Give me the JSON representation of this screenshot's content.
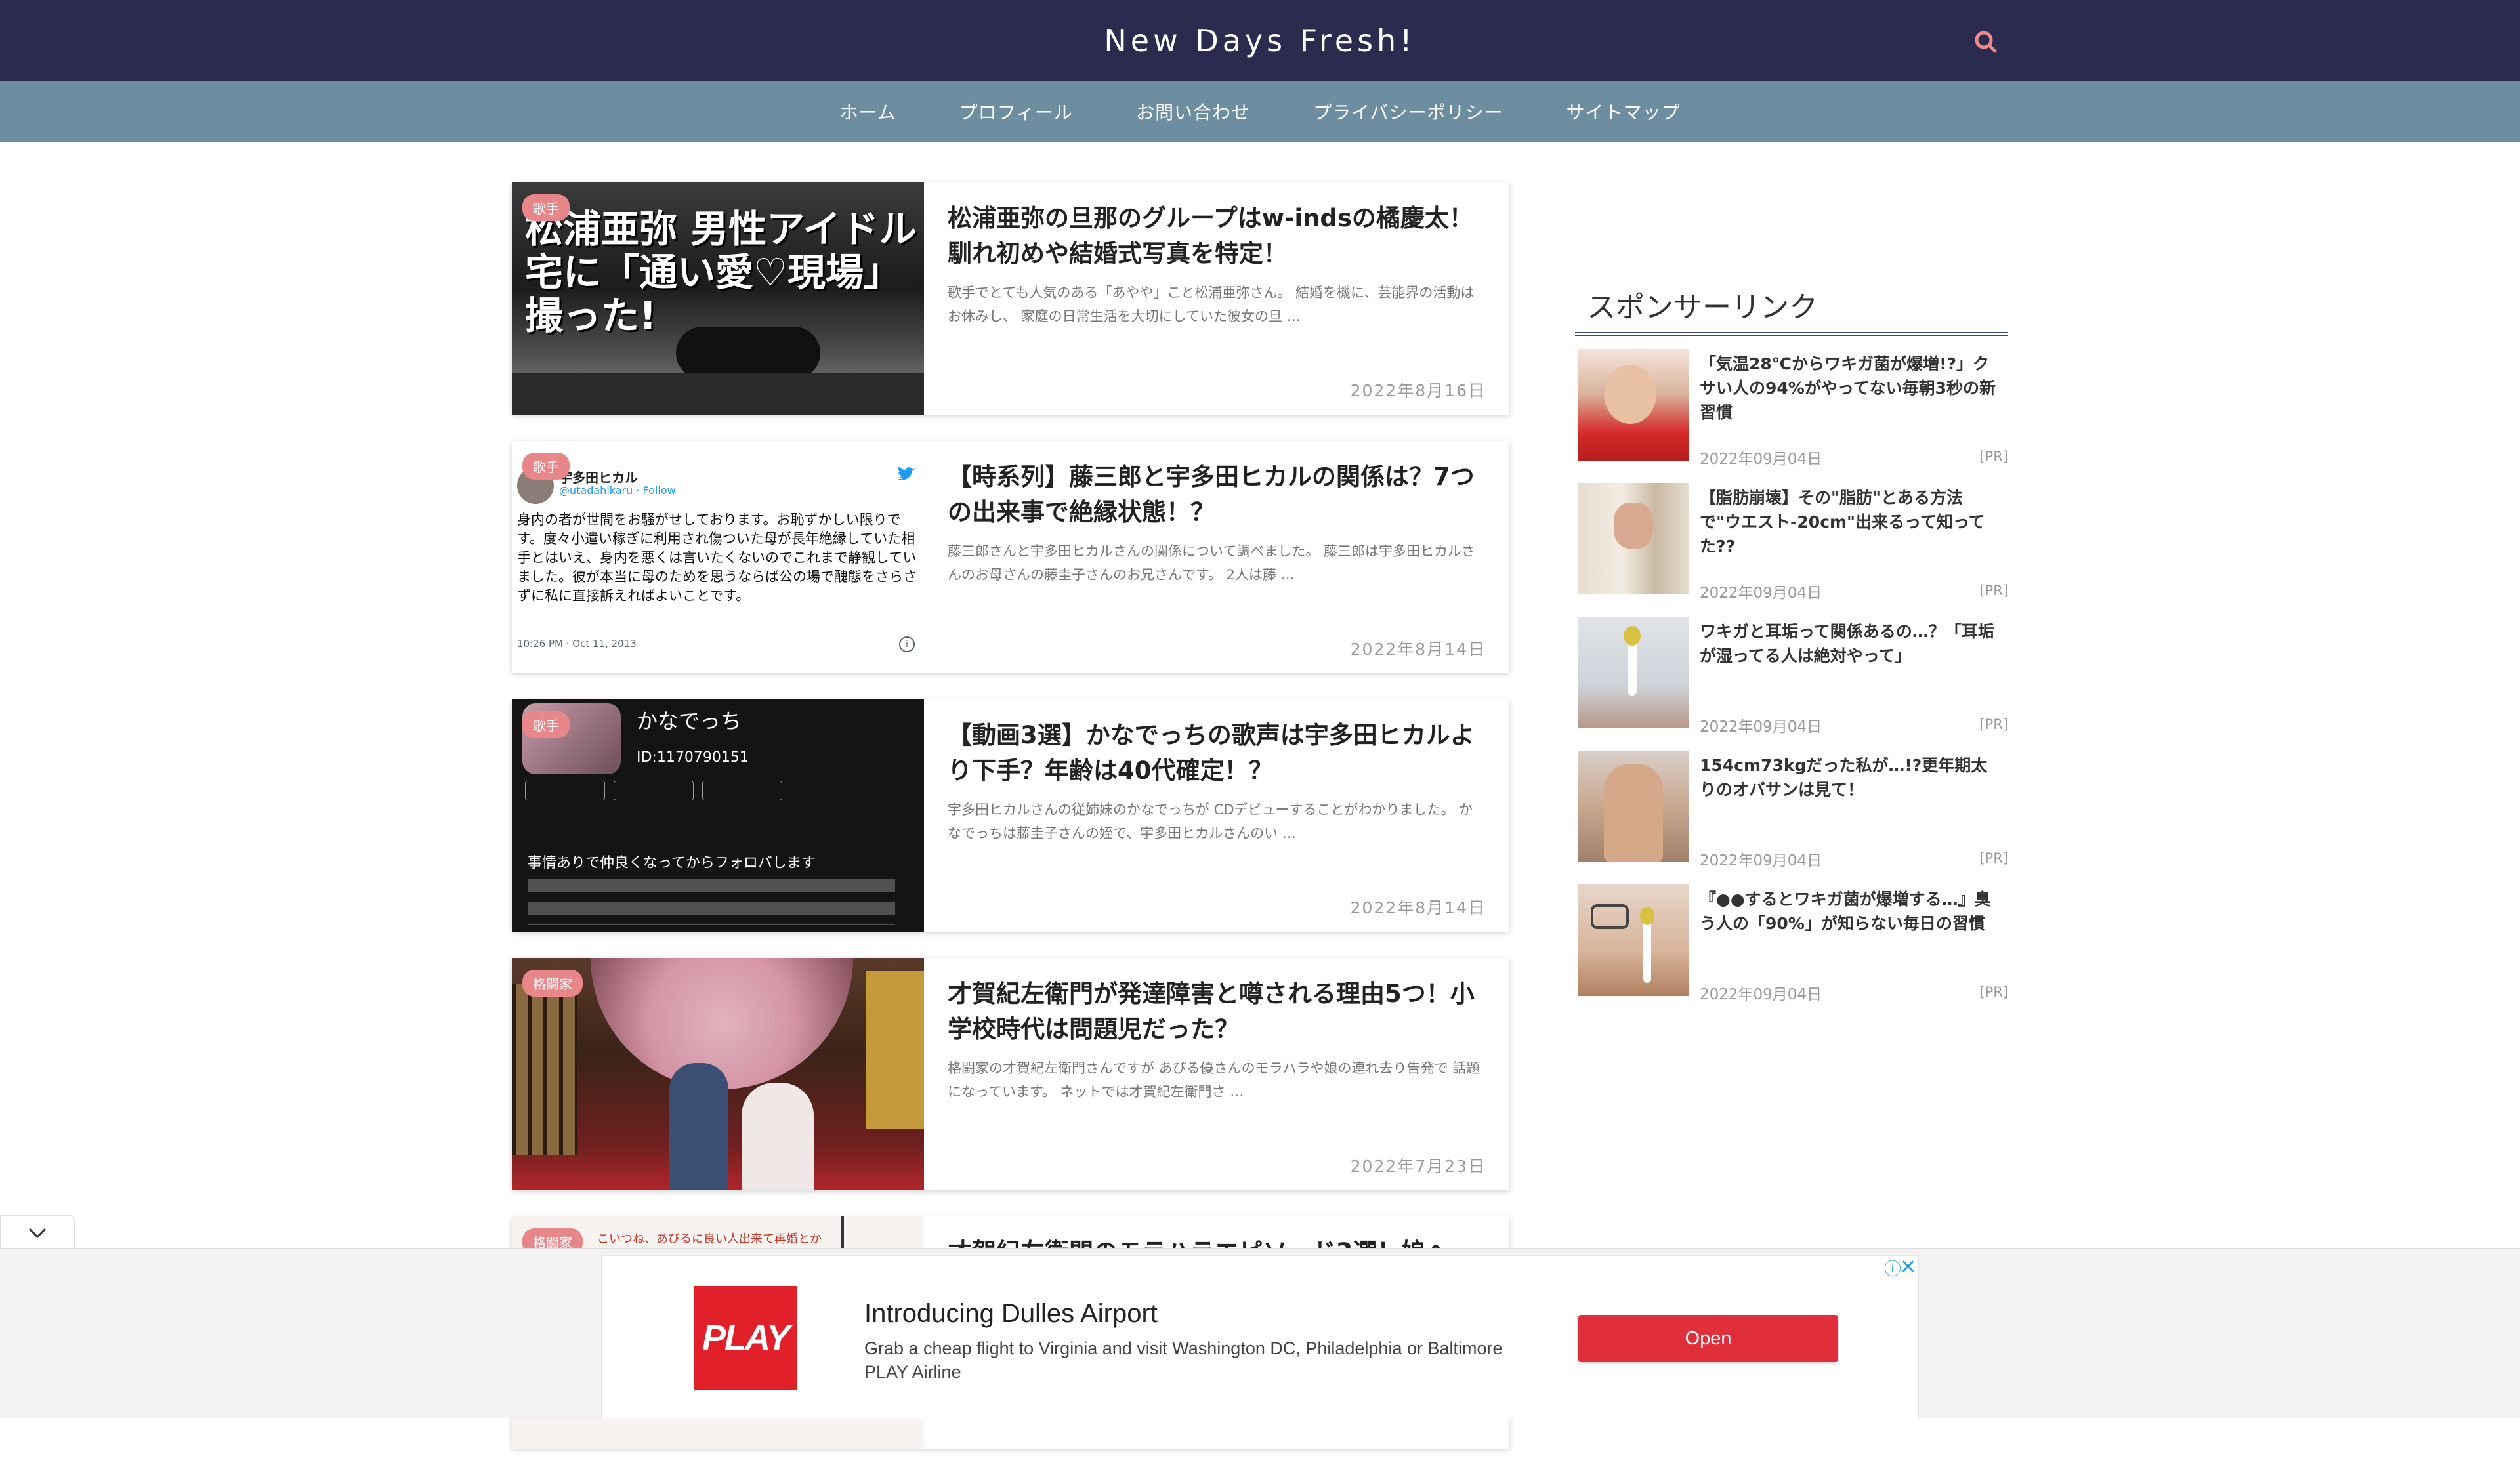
{
  "site": {
    "title": "New Days Fresh!"
  },
  "nav": {
    "items": [
      "ホーム",
      "プロフィール",
      "お問い合わせ",
      "プライバシーポリシー",
      "サイトマップ"
    ]
  },
  "articles": [
    {
      "category": "歌手",
      "title": "松浦亜弥の旦那のグループはw-indsの橘慶太！馴れ初めや結婚式写真を特定！",
      "excerpt": "歌手でとても人気のある「あやや」こと松浦亜弥さん。 結婚を機に、芸能界の活動はお休みし、 家庭の日常生活を大切にしていた彼女の旦 …",
      "date": "2022年8月16日",
      "thumb_text": "松浦亜弥 男性アイドル宅に「通い愛♡現場」撮った!"
    },
    {
      "category": "歌手",
      "title": "【時系列】藤三郎と宇多田ヒカルの関係は？7つの出来事で絶縁状態！？",
      "excerpt": "藤三郎さんと宇多田ヒカルさんの関係について調べました。 藤三郎は宇多田ヒカルさんのお母さんの藤圭子さんのお兄さんです。 2人は藤 …",
      "date": "2022年8月14日",
      "tweet": {
        "name": "宇多田ヒカル",
        "handle": "@utadahikaru · Follow",
        "body": "身内の者が世間をお騒がせしております。お恥ずかしい限りです。度々小遣い稼ぎに利用され傷ついた母が長年絶縁していた相手とはいえ、身内を悪くは言いたくないのでこれまで静観していました。彼が本当に母のためを思うならば公の場で醜態をさらさずに私に直接訴えればよいことです。",
        "time": "10:26 PM · Oct 11, 2013"
      }
    },
    {
      "category": "歌手",
      "title": "【動画3選】かなでっちの歌声は宇多田ヒカルより下手？年齢は40代確定！？",
      "excerpt": "宇多田ヒカルさんの従姉妹のかなでっちが CDデビューすることがわかりました。 かなでっちは藤圭子さんの姪で、宇多田ヒカルさんのい …",
      "date": "2022年8月14日",
      "profile": {
        "name": "かなでっち",
        "id": "ID:1170790151",
        "body": "事情ありで仲良くなってからフォロバします"
      }
    },
    {
      "category": "格闘家",
      "title": "才賀紀左衛門が発達障害と噂される理由5つ！小学校時代は問題児だった？",
      "excerpt": "格闘家の才賀紀左衛門さんですが あびる優さんのモラハラや娘の連れ去り告発で 話題になっています。 ネットでは才賀紀左衛門さ …",
      "date": "2022年7月23日"
    },
    {
      "category": "格闘家",
      "title": "才賀紀左衛門のモラハラエピソード3選！娘へ",
      "thumb_text": "こいつね、あびるに良い人出来て再婚とか"
    }
  ],
  "sidebar": {
    "heading": "スポンサーリンク",
    "items": [
      {
        "title": "「気温28℃からワキガ菌が爆増!?」クサい人の94%がやってない毎朝3秒の新習慣",
        "date": "2022年09月04日",
        "pr": "[PR]"
      },
      {
        "title": "【脂肪崩壊】その\"脂肪\"とある方法で\"ウエスト-20cm\"出来るって知ってた??",
        "date": "2022年09月04日",
        "pr": "[PR]"
      },
      {
        "title": "ワキガと耳垢って関係あるの…？「耳垢が湿ってる人は絶対やって」",
        "date": "2022年09月04日",
        "pr": "[PR]"
      },
      {
        "title": "154cm73kgだった私が…!?更年期太りのオバサンは見て！",
        "date": "2022年09月04日",
        "pr": "[PR]"
      },
      {
        "title": "『●●するとワキガ菌が爆増する…』臭う人の「90%」が知らない毎日の習慣",
        "date": "2022年09月04日",
        "pr": "[PR]"
      }
    ]
  },
  "ad": {
    "logo": "PLAY",
    "title": "Introducing Dulles Airport",
    "description": "Grab a cheap flight to Virginia and visit Washington DC, Philadelphia or Baltimore",
    "brand": "PLAY Airline",
    "cta": "Open"
  },
  "colors": {
    "header": "#2a2b4f",
    "nav": "#6d8ea0",
    "badge": "#e8878a",
    "ad_button": "#e02e3b",
    "search_icon": "#f08a8a"
  }
}
